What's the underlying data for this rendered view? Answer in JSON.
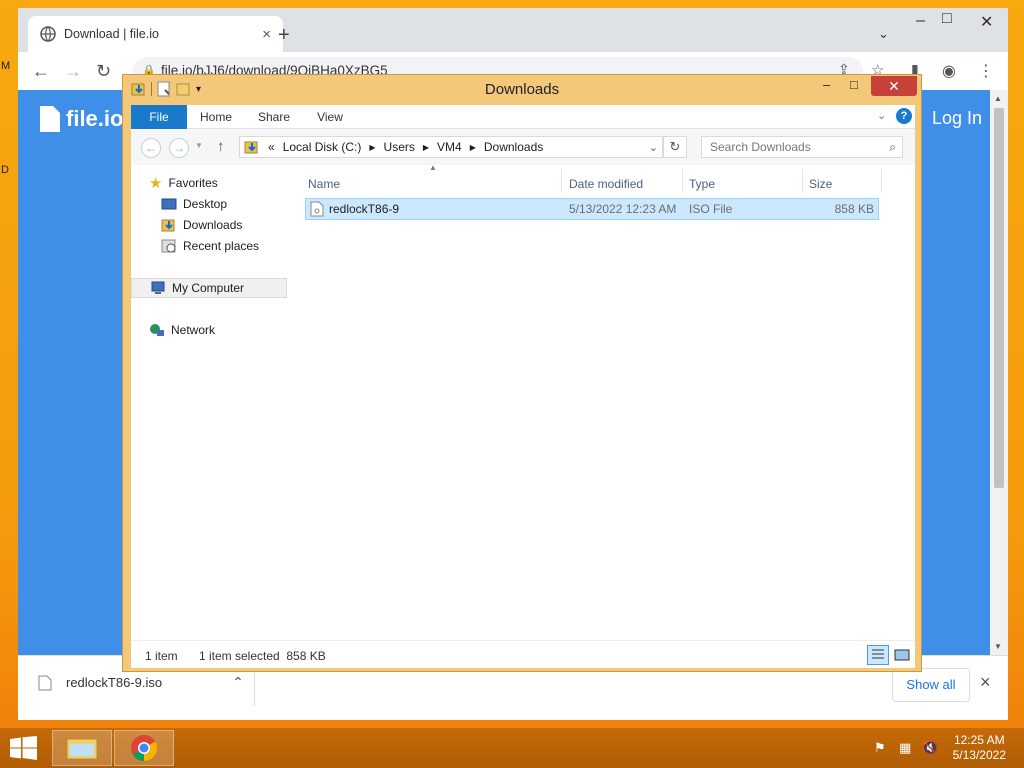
{
  "desktop": {
    "edge_text_1": "M",
    "edge_text_2": "D"
  },
  "chrome": {
    "tab_title": "Download | file.io",
    "tab_close": "×",
    "new_tab": "+",
    "url": "file.io/bJJ6/download/9QiBHa0XzBG5",
    "page": {
      "logo": "file.io",
      "login": "Log In"
    },
    "download_bar": {
      "file_name": "redlockT86-9.iso",
      "show_all": "Show all",
      "close": "×"
    }
  },
  "explorer": {
    "title": "Downloads",
    "ribbon_tabs": [
      "File",
      "Home",
      "Share",
      "View"
    ],
    "address": {
      "prefix": "«",
      "crumbs": [
        "Local Disk (C:)",
        "Users",
        "VM4",
        "Downloads"
      ]
    },
    "search_placeholder": "Search Downloads",
    "nav": {
      "favorites": "Favorites",
      "desktop": "Desktop",
      "downloads": "Downloads",
      "recent": "Recent places",
      "computer": "My Computer",
      "network": "Network"
    },
    "columns": [
      "Name",
      "Date modified",
      "Type",
      "Size"
    ],
    "files": [
      {
        "name": "redlockT86-9",
        "date": "5/13/2022 12:23 AM",
        "type": "ISO File",
        "size": "858 KB"
      }
    ],
    "status": {
      "count": "1 item",
      "selected": "1 item selected  858 KB"
    }
  },
  "taskbar": {
    "time": "12:25 AM",
    "date": "5/13/2022"
  },
  "colors": {
    "ribbon_file": "#1979ca",
    "page_blue": "#3f8ee8",
    "selection": "#cce8ff",
    "window_frame": "#f3c87a"
  }
}
